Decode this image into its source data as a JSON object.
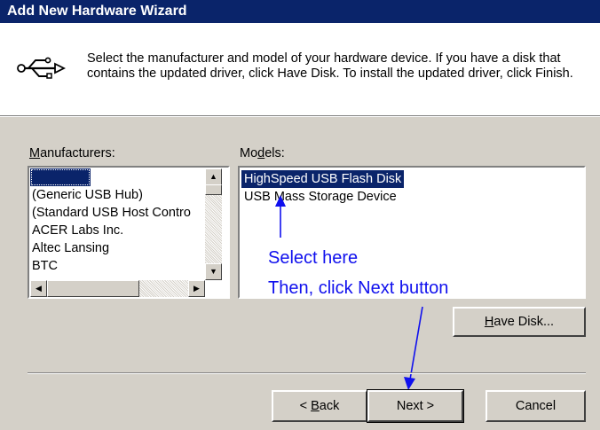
{
  "window": {
    "title": "Add New Hardware Wizard"
  },
  "header": {
    "instruction": "Select the manufacturer and model of your hardware device. If you have a disk that contains the updated driver, click Have Disk. To install the updated driver, click Finish."
  },
  "manufacturers": {
    "label_prefix": "",
    "label_underlined": "M",
    "label_rest": "anufacturers:",
    "items": [
      "",
      "(Generic USB Hub)",
      "(Standard USB Host Contro",
      "ACER Labs Inc.",
      "Altec Lansing",
      "BTC"
    ]
  },
  "models": {
    "label_prefix": "Mo",
    "label_underlined": "d",
    "label_rest": "els:",
    "items": [
      "HighSpeed USB Flash Disk",
      "USB Mass Storage Device"
    ],
    "selected": "HighSpeed USB Flash Disk"
  },
  "annotations": {
    "line1": "Select here",
    "line2": "Then, click Next button",
    "color": "#1010ee"
  },
  "buttons": {
    "have_disk_underlined": "H",
    "have_disk_rest": "ave Disk...",
    "back_prefix": "< ",
    "back_underlined": "B",
    "back_rest": "ack",
    "next": "Next >",
    "cancel": "Cancel"
  },
  "icons": {
    "device": "usb-icon"
  },
  "colors": {
    "titlebar": "#0a246a",
    "face": "#d4d0c8",
    "selection": "#0a246a"
  }
}
